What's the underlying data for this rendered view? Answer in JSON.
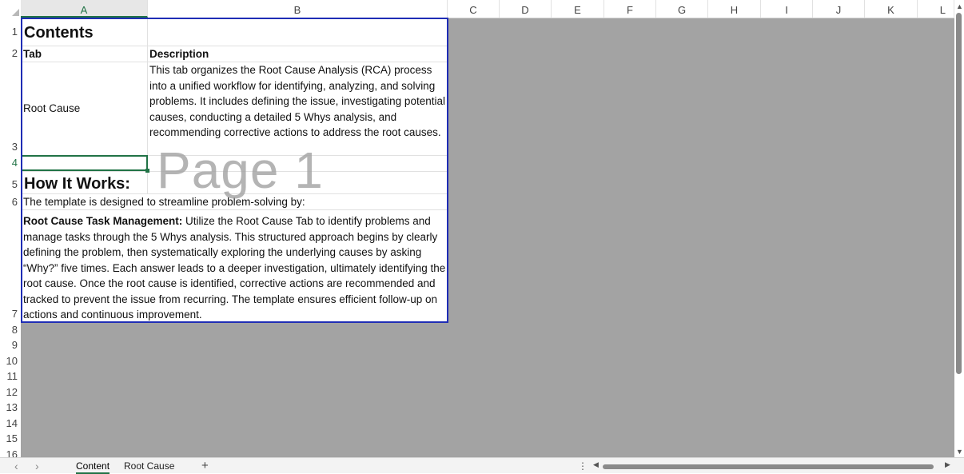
{
  "columns": [
    "A",
    "B",
    "C",
    "D",
    "E",
    "F",
    "G",
    "H",
    "I",
    "J",
    "K",
    "L"
  ],
  "rows": [
    "1",
    "2",
    "3",
    "4",
    "5",
    "6",
    "7",
    "8",
    "9",
    "10",
    "11",
    "12",
    "13",
    "14",
    "15",
    "16"
  ],
  "content": {
    "title": "Contents",
    "tab_header": "Tab",
    "description_header": "Description",
    "root_cause_label": "Root Cause",
    "root_cause_description": "This tab organizes the Root Cause Analysis (RCA) process into a unified workflow for identifying, analyzing, and solving problems. It includes defining the issue, investigating potential causes, conducting a detailed 5 Whys analysis, and recommending corrective actions to address the root causes.",
    "how_it_works_title": "How It Works:",
    "intro": "The template is designed to streamline problem-solving by:",
    "task_mgmt_title": "Root Cause Task Management:",
    "task_mgmt_text": " Utilize the Root Cause Tab to identify problems and manage tasks through the 5 Whys analysis. This structured approach begins by clearly defining the problem, then systematically exploring the underlying causes by asking “Why?” five times. Each answer leads to a deeper investigation, ultimately identifying the root cause. Once the root cause is identified, corrective actions are recommended and tracked to prevent the issue from recurring. The template ensures efficient follow-up on actions and continuous improvement."
  },
  "watermark": "Page 1",
  "sheet_tabs": [
    "Content",
    "Root Cause"
  ],
  "active_tab": "Content",
  "add_sheet": "+",
  "more": "⋮",
  "selected_cell": "A4",
  "colors": {
    "accent": "#217346",
    "page_border": "#1f2db5",
    "out_of_print": "#a3a3a3"
  }
}
